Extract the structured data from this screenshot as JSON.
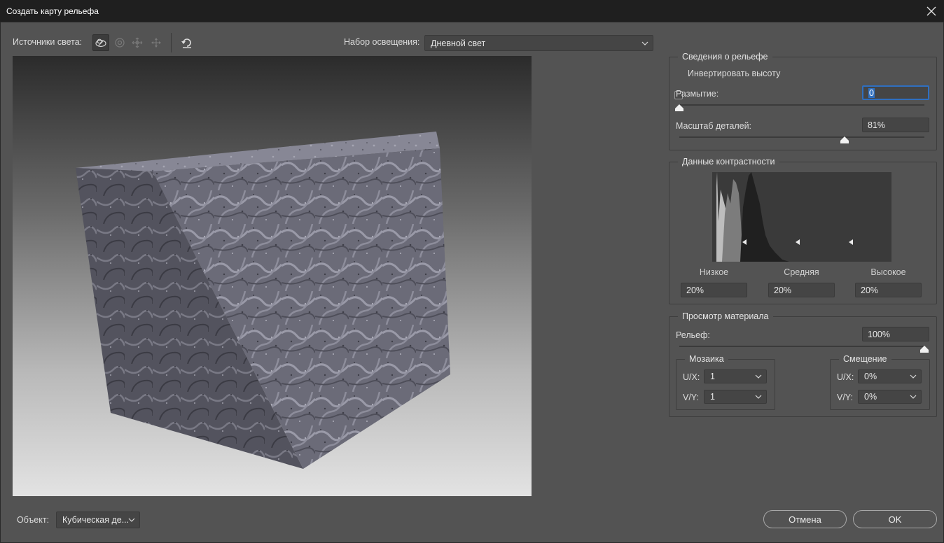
{
  "window": {
    "title": "Создать карту рельефа"
  },
  "toolbar": {
    "light_sources_label": "Источники света:",
    "lighting_preset_label": "Набор освещения:",
    "lighting_preset_value": "Дневной свет"
  },
  "relief_info": {
    "title": "Сведения о рельефе",
    "invert_height_label": "Инвертировать высоту",
    "invert_height_checked": false,
    "blur_label": "Размытие:",
    "blur_value": "0",
    "blur_fraction": 0.0,
    "detail_scale_label": "Масштаб деталей:",
    "detail_scale_value": "81%",
    "detail_scale_fraction": 0.675
  },
  "contrast": {
    "title": "Данные контрастности",
    "low_label": "Низкое",
    "mid_label": "Средняя",
    "high_label": "Высокое",
    "low_value": "20%",
    "mid_value": "20%",
    "high_value": "20%"
  },
  "material": {
    "title": "Просмотр материала",
    "relief_label": "Рельеф:",
    "relief_value": "100%",
    "relief_fraction": 1.0,
    "mosaic": {
      "title": "Мозаика",
      "ux_label": "U/X:",
      "ux_value": "1",
      "vy_label": "V/Y:",
      "vy_value": "1"
    },
    "offset": {
      "title": "Смещение",
      "ux_label": "U/X:",
      "ux_value": "0%",
      "vy_label": "V/Y:",
      "vy_value": "0%"
    }
  },
  "footer": {
    "object_label": "Объект:",
    "object_value": "Кубическая де...",
    "cancel_label": "Отмена",
    "ok_label": "OK"
  },
  "colors": {
    "dialog_bg": "#535353",
    "titlebar_bg": "#1f1f1f",
    "focus_blue": "#2f6fbf"
  }
}
